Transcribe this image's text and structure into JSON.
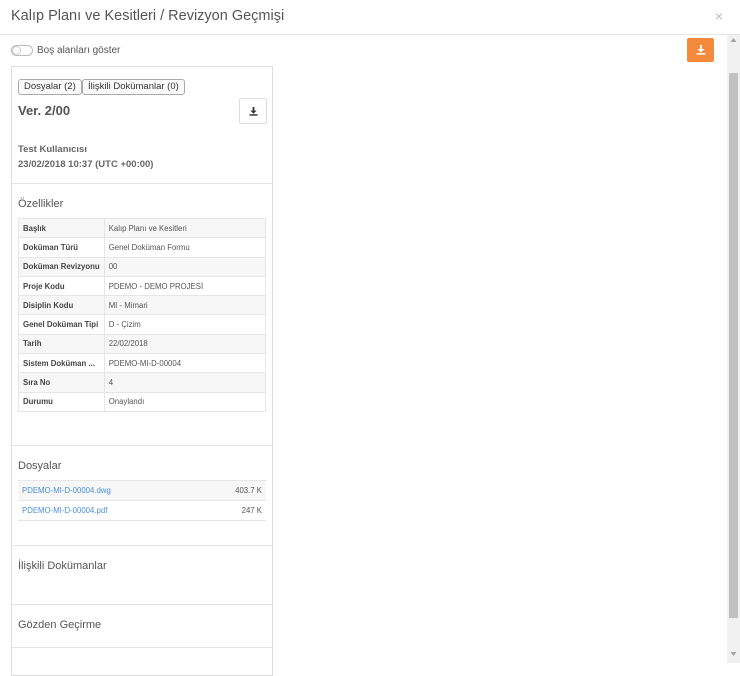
{
  "header": {
    "title": "Kalıp Planı ve Kesitleri / Revizyon Geçmişi",
    "close": "×"
  },
  "toolbar": {
    "toggle_label": "Boş alanları göster",
    "download_icon": "download-icon",
    "accent": "#f58a3c"
  },
  "panel": {
    "tabs": [
      "Dosyalar (2)",
      "İlişkili Dokümanlar (0)"
    ],
    "version": "Ver. 2/00",
    "user": "Test Kullanıcısı",
    "date": "23/02/2018 10:37 (UTC +00:00)",
    "properties_title": "Özellikler",
    "properties": [
      {
        "key": "Başlık",
        "value": "Kalıp Planı ve Kesitleri"
      },
      {
        "key": "Doküman Türü",
        "value": "Genel Doküman Formu"
      },
      {
        "key": "Doküman Revizyonu",
        "value": "00"
      },
      {
        "key": "Proje Kodu",
        "value": "PDEMO - DEMO PROJESİ"
      },
      {
        "key": "Disiplin Kodu",
        "value": "MI - Mimari"
      },
      {
        "key": "Genel Doküman Tipi",
        "value": "D - Çizim"
      },
      {
        "key": "Tarih",
        "value": "22/02/2018"
      },
      {
        "key": "Sistem Doküman ...",
        "value": "PDEMO-MI-D-00004"
      },
      {
        "key": "Sıra No",
        "value": "4"
      },
      {
        "key": "Durumu",
        "value": "Onaylandı"
      }
    ],
    "files_title": "Dosyalar",
    "files": [
      {
        "name": "PDEMO-MI-D-00004.dwg",
        "size": "403.7 K"
      },
      {
        "name": "PDEMO-MI-D-00004.pdf",
        "size": "247 K"
      }
    ],
    "related_title": "İlişkili Dokümanlar",
    "review_title": "Gözden Geçirme"
  }
}
